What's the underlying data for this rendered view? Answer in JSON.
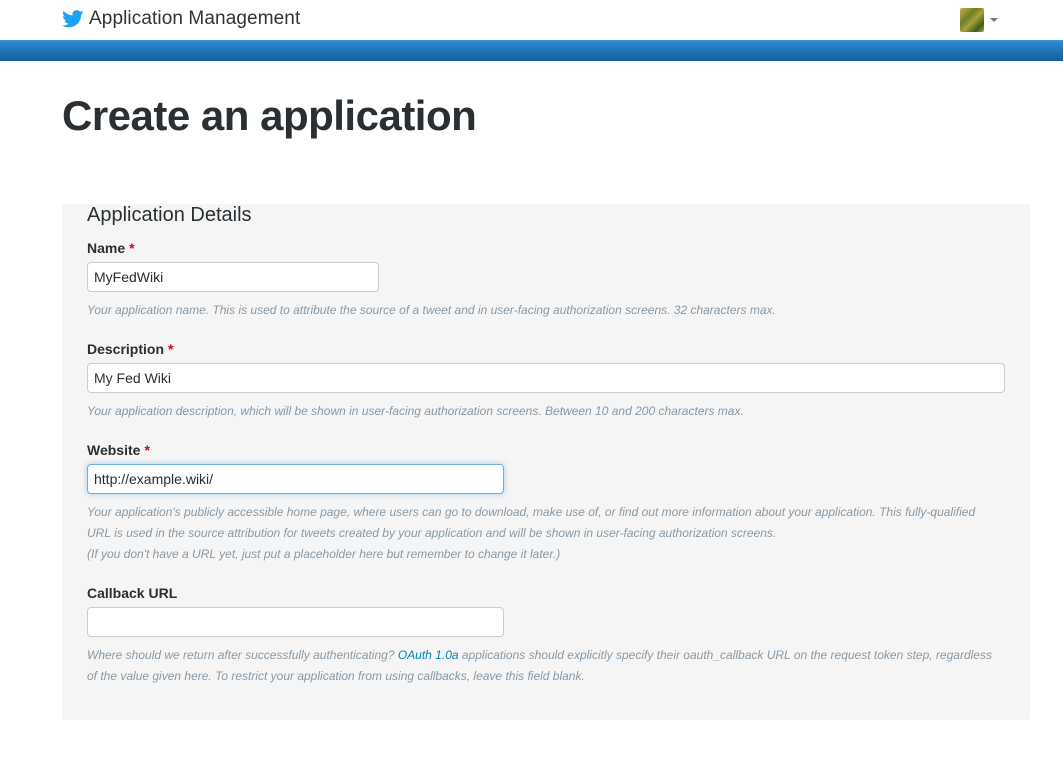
{
  "header": {
    "app_title": "Application Management",
    "logo_icon": "twitter-bird-icon",
    "user_avatar_icon": "avatar-image",
    "user_menu_icon": "caret-down-icon",
    "band_color": "#1b6fb3"
  },
  "page": {
    "title": "Create an application"
  },
  "details": {
    "section_title": "Application Details",
    "required_marker": "*",
    "name": {
      "label": "Name",
      "value": "MyFedWiki",
      "help": "Your application name. This is used to attribute the source of a tweet and in user-facing authorization screens. 32 characters max."
    },
    "description": {
      "label": "Description",
      "value": "My Fed Wiki",
      "help": "Your application description, which will be shown in user-facing authorization screens. Between 10 and 200 characters max."
    },
    "website": {
      "label": "Website",
      "value": "http://example.wiki/",
      "help_line1": "Your application's publicly accessible home page, where users can go to download, make use of, or find out more information about your application. This fully-qualified URL is used in the source attribution for tweets created by your application and will be shown in user-facing authorization screens.",
      "help_line2": "(If you don't have a URL yet, just put a placeholder here but remember to change it later.)"
    },
    "callback": {
      "label": "Callback URL",
      "value": "",
      "help_before": "Where should we return after successfully authenticating? ",
      "help_link": "OAuth 1.0a",
      "help_after": " applications should explicitly specify their oauth_callback URL on the request token step, regardless of the value given here. To restrict your application from using callbacks, leave this field blank."
    }
  }
}
